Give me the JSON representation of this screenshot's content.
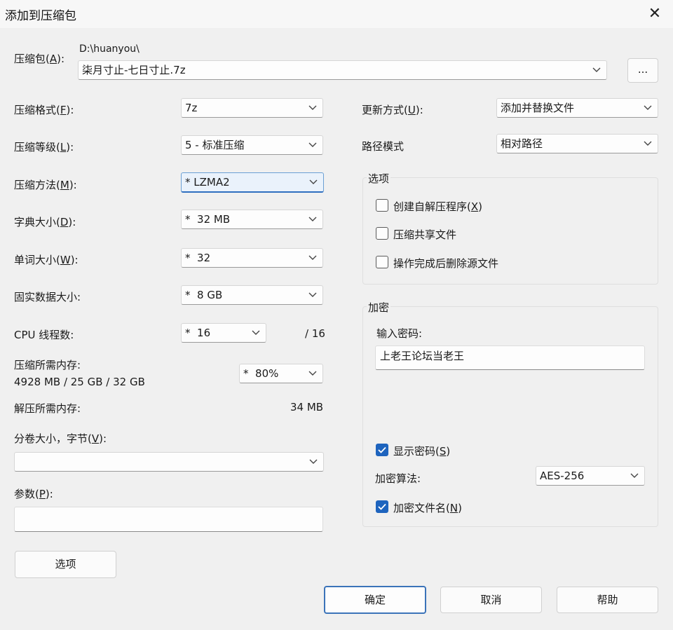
{
  "window": {
    "title": "添加到压缩包",
    "close_glyph": "✕"
  },
  "archive": {
    "label_prefix": "压缩包(",
    "label_key": "A",
    "label_suffix": "):",
    "path": "D:\\huanyou\\",
    "filename": "柒月寸止-七日寸止.7z",
    "browse_label": "..."
  },
  "left": {
    "format": {
      "prefix": "压缩格式(",
      "key": "F",
      "suffix": "):",
      "value": "7z"
    },
    "level": {
      "prefix": "压缩等级(",
      "key": "L",
      "suffix": "):",
      "value": "5 - 标准压缩"
    },
    "method": {
      "prefix": "压缩方法(",
      "key": "M",
      "suffix": "):",
      "value": "* LZMA2"
    },
    "dict": {
      "prefix": "字典大小(",
      "key": "D",
      "suffix": "):",
      "value": "*  32 MB"
    },
    "word": {
      "prefix": "单词大小(",
      "key": "W",
      "suffix": "):",
      "value": "*  32"
    },
    "solid": {
      "label": "固实数据大小:",
      "value": "*  8 GB"
    },
    "threads": {
      "label": "CPU 线程数:",
      "value": "*  16",
      "max": "/ 16"
    },
    "mem_compress": {
      "label": "压缩所需内存:",
      "detail": "4928 MB / 25 GB / 32 GB",
      "value": "*  80%"
    },
    "mem_decompress": {
      "label": "解压所需内存:",
      "value": "34 MB"
    },
    "volume": {
      "prefix": "分卷大小，字节(",
      "key": "V",
      "suffix": "):",
      "value": ""
    },
    "params": {
      "prefix": "参数(",
      "key": "P",
      "suffix": "):",
      "value": ""
    },
    "options_button": "选项"
  },
  "right": {
    "update": {
      "prefix": "更新方式(",
      "key": "U",
      "suffix": "):",
      "value": "添加并替换文件"
    },
    "path_mode": {
      "label": "路径模式",
      "value": "相对路径"
    },
    "options_group": {
      "title": "选项",
      "items": [
        {
          "prefix": "创建自解压程序(",
          "key": "X",
          "suffix": ")",
          "checked": false
        },
        {
          "label": "压缩共享文件",
          "checked": false
        },
        {
          "label": "操作完成后删除源文件",
          "checked": false
        }
      ]
    },
    "encryption": {
      "title": "加密",
      "password_label": "输入密码:",
      "password_value": "上老王论坛当老王",
      "show_password": {
        "prefix": "显示密码(",
        "key": "S",
        "suffix": ")",
        "checked": true
      },
      "method_label": "加密算法:",
      "method_value": "AES-256",
      "encrypt_names": {
        "prefix": "加密文件名(",
        "key": "N",
        "suffix": ")",
        "checked": true
      }
    }
  },
  "buttons": {
    "ok": "确定",
    "cancel": "取消",
    "help": "帮助"
  },
  "colors": {
    "accent": "#1e64be",
    "focus_border": "#2f6fc0",
    "background": "#f0f0f0"
  }
}
